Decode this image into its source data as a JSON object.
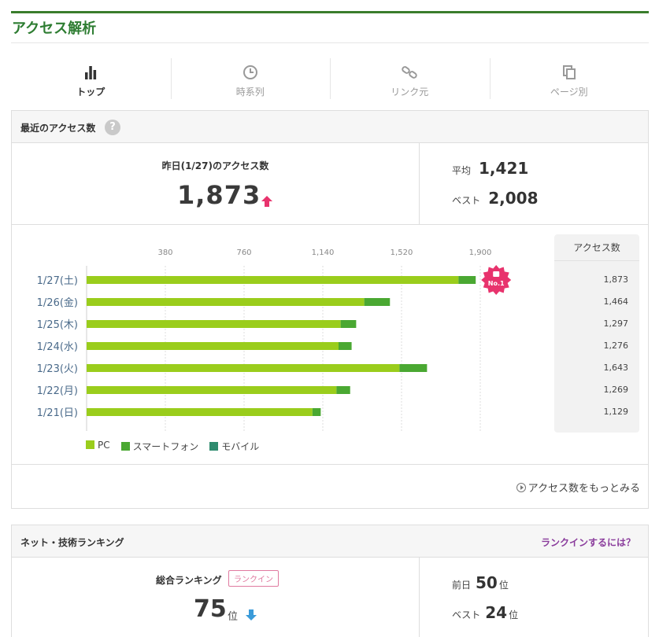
{
  "page": {
    "title": "アクセス解析"
  },
  "tabs": [
    {
      "label": "トップ",
      "icon": "bar-chart-icon",
      "active": true
    },
    {
      "label": "時系列",
      "icon": "clock-icon",
      "active": false
    },
    {
      "label": "リンク元",
      "icon": "link-icon",
      "active": false
    },
    {
      "label": "ページ別",
      "icon": "pages-icon",
      "active": false
    }
  ],
  "access": {
    "section_title": "最近のアクセス数",
    "help_glyph": "?",
    "yesterday_label": "昨日(1/27)のアクセス数",
    "yesterday_value": "1,873",
    "avg_label": "平均",
    "avg_value": "1,421",
    "best_label": "ベスト",
    "best_value": "2,008",
    "side_header": "アクセス数",
    "more_link": "アクセス数をもっとみる",
    "badge_text": "No.1"
  },
  "chart_data": {
    "type": "bar",
    "orientation": "horizontal",
    "stacked": true,
    "categories": [
      "1/27(土)",
      "1/26(金)",
      "1/25(木)",
      "1/24(水)",
      "1/23(火)",
      "1/22(月)",
      "1/21(日)"
    ],
    "x_ticks": [
      "380",
      "760",
      "1,140",
      "1,520",
      "1,900"
    ],
    "xlim": [
      0,
      1900
    ],
    "series": [
      {
        "name": "PC",
        "color": "#9acd1c",
        "values": [
          1795,
          1340,
          1226,
          1216,
          1510,
          1206,
          1090
        ]
      },
      {
        "name": "スマートフォン",
        "color": "#4aa832",
        "values": [
          83,
          124,
          75,
          63,
          133,
          66,
          40
        ]
      },
      {
        "name": "モバイル",
        "color": "#2e8b6e",
        "values": [
          0,
          0,
          0,
          0,
          0,
          0,
          0
        ]
      }
    ],
    "totals": [
      "1,873",
      "1,464",
      "1,297",
      "1,276",
      "1,643",
      "1,269",
      "1,129"
    ],
    "grid": true,
    "legend": "bottom-left"
  },
  "ranking": {
    "section_title": "ネット・技術ランキング",
    "link": "ランクインするには？",
    "overall_label": "総合ランキング",
    "badge": "ランクイン",
    "overall_value": "75",
    "unit": "位",
    "prev_label": "前日",
    "prev_value": "50",
    "best_label": "ベスト",
    "best_value": "24"
  },
  "colors": {
    "accent": "#2e7d32",
    "up": "#e8336d",
    "down": "#3a9bd9",
    "rank_link": "#8a3c9c"
  }
}
